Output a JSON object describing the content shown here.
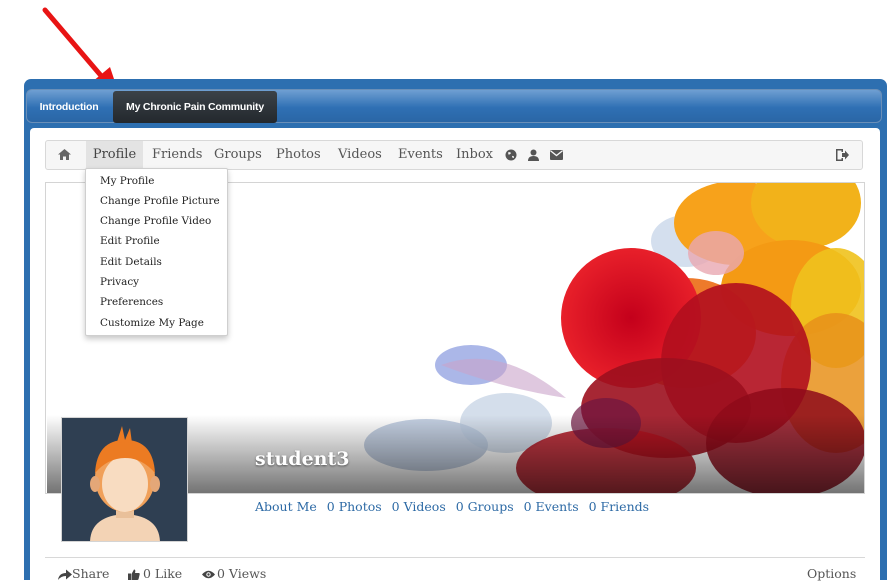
{
  "tabs": {
    "introduction": "Introduction",
    "community": "My Chronic Pain Community"
  },
  "nav": {
    "items": [
      "Profile",
      "Friends",
      "Groups",
      "Photos",
      "Videos",
      "Events",
      "Inbox"
    ],
    "icons": [
      "home-icon",
      "globe-icon",
      "user-icon",
      "mail-icon",
      "logout-icon"
    ]
  },
  "profile_menu": [
    "My Profile",
    "Change Profile Picture",
    "Change Profile Video",
    "Edit Profile",
    "Edit Details",
    "Privacy",
    "Preferences",
    "Customize My Page"
  ],
  "profile": {
    "username": "student3",
    "links": [
      "About Me",
      "0 Photos",
      "0 Videos",
      "0 Groups",
      "0 Events",
      "0 Friends"
    ]
  },
  "footer": {
    "share": "Share",
    "like": "0 Like",
    "views": "0 Views",
    "options": "Options"
  },
  "colors": {
    "annotation_arrow": "#e81414",
    "tab_bar": "#2f70b4",
    "active_tab": "#2a3036",
    "link": "#2d6aa5"
  }
}
